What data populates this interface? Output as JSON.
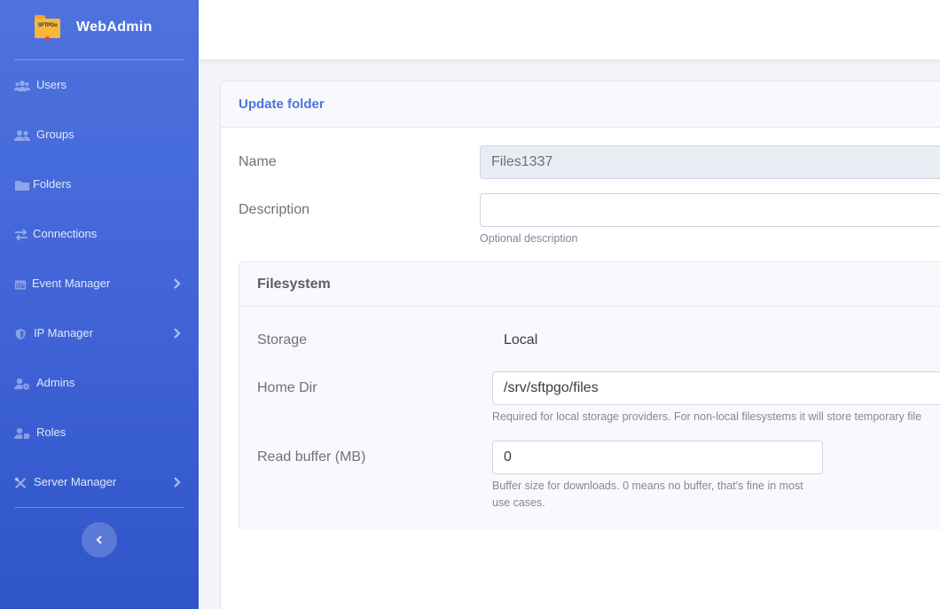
{
  "brand": {
    "logo_text": "SFTPGo",
    "name": "WebAdmin"
  },
  "sidebar": {
    "items": [
      {
        "label": "Users",
        "icon": "users-icon",
        "has_submenu": false
      },
      {
        "label": "Groups",
        "icon": "user-group-icon",
        "has_submenu": false
      },
      {
        "label": "Folders",
        "icon": "folder-icon",
        "has_submenu": false
      },
      {
        "label": "Connections",
        "icon": "exchange-arrows-icon",
        "has_submenu": false
      },
      {
        "label": "Event Manager",
        "icon": "calendar-icon",
        "has_submenu": true
      },
      {
        "label": "IP Manager",
        "icon": "shield-icon",
        "has_submenu": true
      },
      {
        "label": "Admins",
        "icon": "user-cog-icon",
        "has_submenu": false
      },
      {
        "label": "Roles",
        "icon": "user-tag-icon",
        "has_submenu": false
      },
      {
        "label": "Server Manager",
        "icon": "tools-icon",
        "has_submenu": true
      }
    ],
    "collapse_icon": "chevron-left-icon"
  },
  "form": {
    "title": "Update folder",
    "name": {
      "label": "Name",
      "value": "Files1337"
    },
    "description": {
      "label": "Description",
      "value": "",
      "help": "Optional description"
    },
    "filesystem": {
      "title": "Filesystem",
      "storage": {
        "label": "Storage",
        "value": "Local"
      },
      "home_dir": {
        "label": "Home Dir",
        "value": "/srv/sftpgo/files",
        "help": "Required for local storage providers. For non-local filesystems it will store temporary file"
      },
      "read_buffer": {
        "label": "Read buffer (MB)",
        "value": "0",
        "help_line1": "Buffer size for downloads. 0 means no buffer, that's fine in most",
        "help_line2": "use cases."
      }
    }
  },
  "colors": {
    "primary": "#4e73df",
    "sidebar_bottom": "#2f55c9"
  }
}
